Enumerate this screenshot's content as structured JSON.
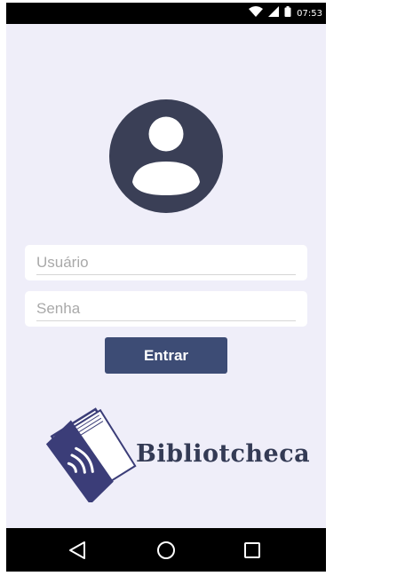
{
  "status_bar": {
    "time": "07:53",
    "icons": [
      "wifi-icon",
      "cell-signal-icon",
      "battery-icon"
    ]
  },
  "login": {
    "avatar_icon": "account-circle-icon",
    "username_placeholder": "Usuário",
    "password_placeholder": "Senha",
    "submit_label": "Entrar"
  },
  "brand": {
    "logo_icon": "open-book-icon",
    "name": "Bibliotcheca"
  },
  "nav_bar": {
    "icons": [
      "back-icon",
      "home-icon",
      "recent-apps-icon"
    ]
  },
  "colors": {
    "background": "#efeef9",
    "accent": "#3d4c75",
    "avatar": "#3a3f56",
    "brand_text": "#343b55",
    "logo": "#3b3d78"
  }
}
